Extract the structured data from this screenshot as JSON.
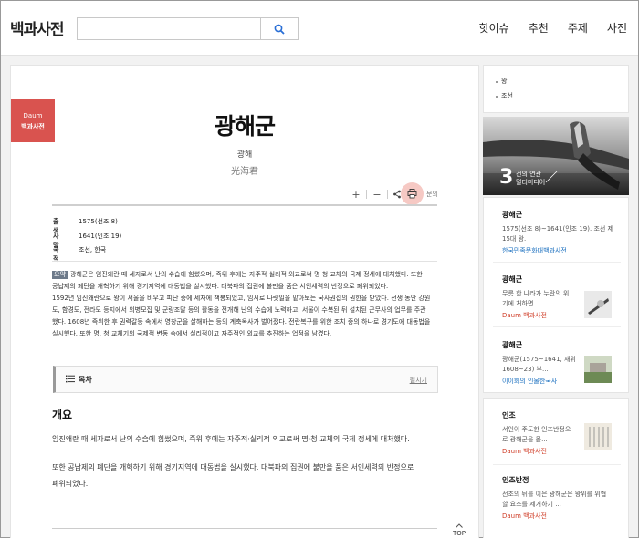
{
  "header": {
    "logo": "백과사전",
    "search": {
      "value": "",
      "placeholder": ""
    },
    "nav": [
      "핫이슈",
      "추천",
      "주제",
      "사전"
    ]
  },
  "badge": {
    "top": "Daum",
    "bottom": "백과사전"
  },
  "article": {
    "title": "광해군",
    "reading": "광해",
    "hanja": "光海君",
    "toolbar": {
      "plus": "+",
      "minus": "−",
      "lang_link": "문의"
    },
    "info": [
      {
        "label": "출생",
        "value": "1575(선조 8)"
      },
      {
        "label": "사망",
        "value": "1641(인조 19)"
      },
      {
        "label": "국적",
        "value": "조선, 한국"
      }
    ],
    "summary_tag": "요약",
    "summary_lines": [
      "광해군은 임진왜란 때 세자로서 난의 수습에 힘썼으며, 즉위 후에는 자주적·실리적 외교로써 명·청 교체의 국제 정세에 대처했다. 또한",
      "공납제의 폐단을 개혁하기 위해 경기지역에 대동법을 실시했다. 대북파의 집권에 불만을 품은 서인세력의 반정으로 폐위되었다.",
      "1592년 임진왜란으로 왕이 서울을 비우고 피난 중에 세자에 책봉되었고, 임시로 나랏일을 맡아보는 국사권섭의 권한을 받았다. 전쟁 동안 강원",
      "도, 함경도, 전라도 등지에서 의병모집 및 군량조달 등의 활동을 전개해 난의 수습에 노력하고, 서울이 수복된 뒤 설치된 군무사의 업무를 주관",
      "했다. 1608년 즉위한 후 권력갈등 속에서 영창군을 살해하는 등의 계축옥사가 벌어졌다. 전란복구를 위한 조치 중의 하나로 경기도에 대동법을",
      "실시했다. 또한 명, 청 교체기의 국제적 변동 속에서 실리적이고 자주적인 외교를 추진하는 업적을 남겼다."
    ],
    "toc_label": "목차",
    "toc_toggle": "펼치기",
    "section_title": "개요",
    "para1": "임진왜란 때 세자로서 난의 수습에 힘썼으며, 즉위 후에는 자주적·실리적 외교로써 명·청 교체의 국제 정세에 대처했다.",
    "para2_line1": "또한 공납제의 폐단을 개혁하기 위해 경기지역에 대동법을 실시했다. 대북파의 집권에 불만을 품은 서인세력의 반정으로",
    "para2_line2": "폐위되었다.",
    "top_label": "TOP"
  },
  "sidebar": {
    "categories": [
      "왕",
      "조선"
    ],
    "media": {
      "count": "3",
      "text_line1": "건의 연관",
      "text_line2": "멀티미디어"
    },
    "entries": [
      {
        "title": "광해군",
        "desc1": "1575(선조 8)~1641(인조 19). 조선 제",
        "desc2": "15대 왕.",
        "source": "한국민족문화대백과사전",
        "source_color": "#1a6fbf"
      },
      {
        "title": "광해군",
        "desc1": "무릇 한 나라가 누란의 위",
        "desc2": "기에 처하면 ...",
        "source": "Daum 백과사전",
        "source_color": "#d0402b"
      },
      {
        "title": "광해군",
        "desc1": "광해군(1575~1641, 재위",
        "desc2": "1608~23) 부...",
        "source": "이이화의 인물한국사",
        "source_color": "#1a6fbf"
      },
      {
        "title": "인조",
        "desc1": "서인이 주도한 인조반정으",
        "desc2": "로 광해군을 몰...",
        "source": "Daum 백과사전",
        "source_color": "#d0402b"
      },
      {
        "title": "인조반정",
        "desc1": "선조의 뒤를 이은 광해군은 왕위를 위협",
        "desc2": "할 요소를 제거하기 ...",
        "source": "Daum 백과사전",
        "source_color": "#d0402b"
      }
    ]
  },
  "colors": {
    "accent_red": "#d9534f",
    "link_blue": "#1a6fbf",
    "source_red": "#d0402b"
  }
}
